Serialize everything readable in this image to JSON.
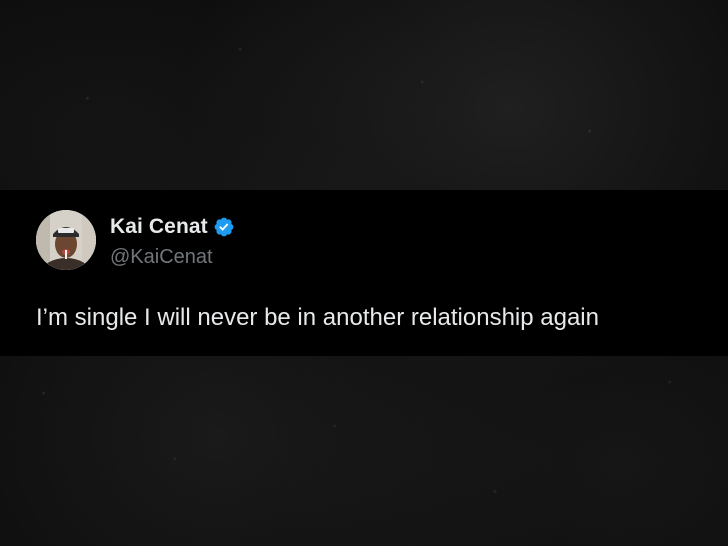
{
  "tweet": {
    "author": {
      "display_name": "Kai Cenat",
      "handle": "@KaiCenat",
      "verified": true,
      "avatar_icon": "profile-photo"
    },
    "text": "I’m single I will never be in another relationship again"
  },
  "colors": {
    "card_background": "#000000",
    "text_primary": "#e7e9ea",
    "text_secondary": "#71767b",
    "verified_blue": "#1d9bf0"
  }
}
